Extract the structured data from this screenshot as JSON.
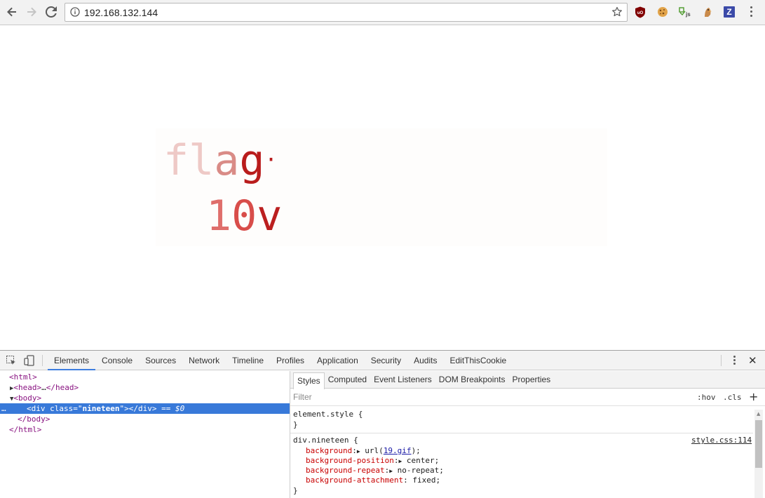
{
  "browser": {
    "url": "192.168.132.144",
    "extensions": [
      "ublock-origin-icon",
      "cookie-icon",
      "javascript-toggle-icon",
      "bird-icon",
      "zotero-icon"
    ],
    "z_label": "Z"
  },
  "page": {
    "gif_line1_a": "fl",
    "gif_line1_b": "a",
    "gif_line1_c": "g",
    "gif_line1_d": "·",
    "gif_line2_a": "1",
    "gif_line2_b": "0",
    "gif_line2_c": "v"
  },
  "devtools": {
    "tabs": [
      "Elements",
      "Console",
      "Sources",
      "Network",
      "Timeline",
      "Profiles",
      "Application",
      "Security",
      "Audits",
      "EditThisCookie"
    ],
    "close": "✕",
    "dom": {
      "html_open": "<html>",
      "head": "<head>",
      "head_ellipsis": "…",
      "head_close": "</head>",
      "body_open": "<body>",
      "div_open": "<div",
      "class_attr": "class",
      "class_eq": "=\"",
      "class_val": "nineteen",
      "class_end": "\">",
      "div_close": "</div>",
      "eq_dollar": "== $0",
      "dots": "…",
      "body_close": "</body>",
      "html_close": "</html>"
    },
    "styles": {
      "subtabs": [
        "Styles",
        "Computed",
        "Event Listeners",
        "DOM Breakpoints",
        "Properties"
      ],
      "filter_placeholder": "Filter",
      "hov": ":hov",
      "cls": ".cls",
      "plus": "+",
      "element_style": "element.style {",
      "close_brace": "}",
      "rule_selector": "div.nineteen {",
      "source": "style.css:114",
      "declarations": [
        {
          "prop": "background",
          "val_pre": "url(",
          "link": "19.gif",
          "val_post": ");",
          "arrow": true
        },
        {
          "prop": "background-position",
          "val": "center;",
          "arrow": true
        },
        {
          "prop": "background-repeat",
          "val": "no-repeat;",
          "arrow": true
        },
        {
          "prop": "background-attachment",
          "val": "fixed;",
          "arrow": false
        }
      ]
    }
  }
}
